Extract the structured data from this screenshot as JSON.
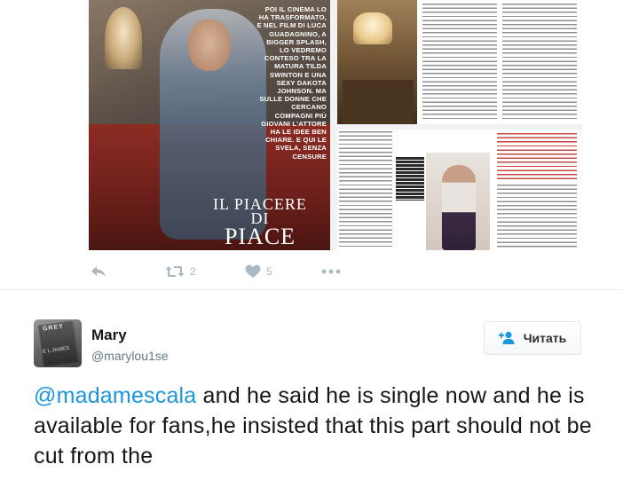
{
  "tweet1": {
    "media": {
      "pullquote": "POI IL CINEMA LO HA TRASFORMATO, E NEL FILM DI LUCA GUADAGNINO, A BIGGER SPLASH, LO VEDREMO CONTESO TRA LA MATURA TILDA SWINTON E UNA SEXY DAKOTA JOHNSON. MA SULLE DONNE CHE CERCANO COMPAGNI PIÙ GIOVANI L'ATTORE HA LE IDEE BEN CHIARE. E QUI LE SVELA, SENZA CENSURE",
      "mag_title_line1": "IL PIACERE",
      "mag_title_line2": "DI",
      "mag_title_line3": "PIACE"
    },
    "actions": {
      "reply_icon": "reply-icon",
      "retweet_icon": "retweet-icon",
      "retweet_count": "2",
      "like_icon": "heart-icon",
      "like_count": "5",
      "more_icon": "more-dots-icon"
    }
  },
  "tweet2": {
    "user": {
      "name": "Mary",
      "handle": "@marylou1se",
      "avatar_book_title": "GREY",
      "avatar_book_author": "E L JAMES"
    },
    "follow_button": {
      "label": "Читать",
      "icon": "add-user-icon"
    },
    "text": {
      "mention": "@madamescala",
      "body": "  and he said he is single now and he is available for fans,he insisted that this part should not be cut from the"
    }
  },
  "colors": {
    "accent_link": "#1b95e0",
    "icon_gray": "#aab8c2",
    "handle_gray": "#657786",
    "divider": "#e6ecf0"
  }
}
